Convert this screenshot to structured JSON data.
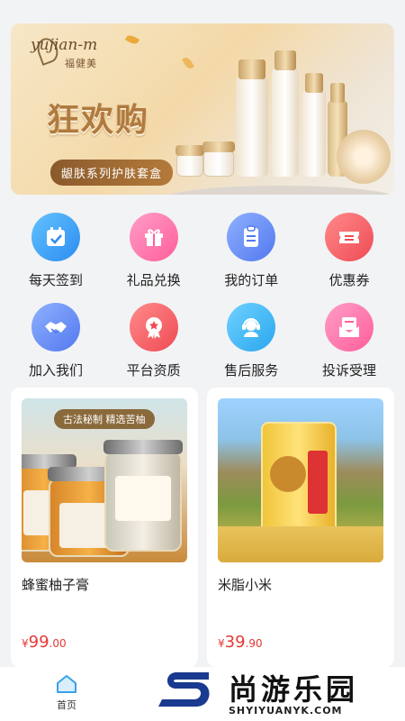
{
  "banner": {
    "brand_en": "yujian-m",
    "brand_cn": "福健美",
    "headline": "狂欢购",
    "subline": "龈肤系列护肤套盒"
  },
  "grid": {
    "row1": [
      {
        "label": "每天签到",
        "icon": "calendar-check-icon",
        "color": "#2d8cf0"
      },
      {
        "label": "礼品兑换",
        "icon": "gift-icon",
        "color": "#ff5e9a"
      },
      {
        "label": "我的订单",
        "icon": "order-list-icon",
        "color": "#5279ef"
      },
      {
        "label": "优惠券",
        "icon": "coupon-icon",
        "color": "#ee4b54"
      }
    ],
    "row2": [
      {
        "label": "加入我们",
        "icon": "handshake-icon",
        "color": "#5279ef"
      },
      {
        "label": "平台资质",
        "icon": "award-badge-icon",
        "color": "#ee4b54"
      },
      {
        "label": "售后服务",
        "icon": "customer-service-icon",
        "color": "#2aa6ee"
      },
      {
        "label": "投诉受理",
        "icon": "complaint-mail-icon",
        "color": "#ff5e9a"
      }
    ]
  },
  "products": [
    {
      "name": "蜂蜜柚子膏",
      "currency": "¥",
      "price_int": "99",
      "price_dec": ".00",
      "tagline": "古法秘制 精选苦柚"
    },
    {
      "name": "米脂小米",
      "currency": "¥",
      "price_int": "39",
      "price_dec": ".90"
    }
  ],
  "tabbar": {
    "home_label": "首页"
  },
  "watermark": {
    "text": "尚游乐园",
    "url": "SHYIYUANYK.COM"
  }
}
